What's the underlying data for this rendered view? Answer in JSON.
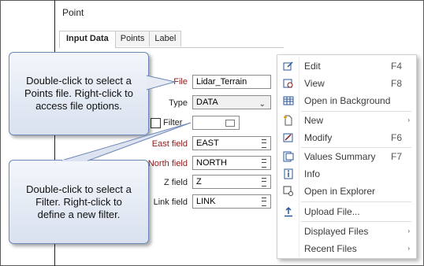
{
  "panel": {
    "title": "Point"
  },
  "tabs": [
    {
      "label": "Input Data"
    },
    {
      "label": "Points"
    },
    {
      "label": "Label"
    }
  ],
  "form": {
    "file_label": "File",
    "file_value": "Lidar_Terrain",
    "type_label": "Type",
    "type_value": "DATA",
    "filter_label": "Filter",
    "east_label": "East field",
    "east_value": "EAST",
    "north_label": "North field",
    "north_value": "NORTH",
    "z_label": "Z field",
    "z_value": "Z",
    "link_label": "Link field",
    "link_value": "LINK"
  },
  "callouts": {
    "top_lines": [
      "Double-click to select a",
      "Points file. Right-click to",
      "access file options."
    ],
    "bottom_lines": [
      "Double-click to select a",
      "Filter. Right-click to",
      "define a new filter."
    ]
  },
  "menu": {
    "items": [
      {
        "label": "Edit",
        "shortcut": "F4",
        "icon": "edit-icon"
      },
      {
        "label": "View",
        "shortcut": "F8",
        "icon": "view-icon"
      },
      {
        "label": "Open in Background",
        "shortcut": "",
        "icon": "table-icon"
      },
      {
        "label": "New",
        "shortcut": "",
        "icon": "new-icon",
        "submenu": "›"
      },
      {
        "label": "Modify",
        "shortcut": "F6",
        "icon": "modify-icon"
      },
      {
        "label": "Values Summary",
        "shortcut": "F7",
        "icon": "summary-icon"
      },
      {
        "label": "Info",
        "shortcut": "",
        "icon": "info-icon"
      },
      {
        "label": "Open in Explorer",
        "shortcut": "",
        "icon": "explorer-icon"
      },
      {
        "label": "Upload File...",
        "shortcut": "",
        "icon": "upload-icon"
      },
      {
        "label": "Displayed Files",
        "shortcut": "",
        "icon": "",
        "submenu": "›"
      },
      {
        "label": "Recent Files",
        "shortcut": "",
        "icon": "",
        "submenu": "›"
      }
    ]
  }
}
